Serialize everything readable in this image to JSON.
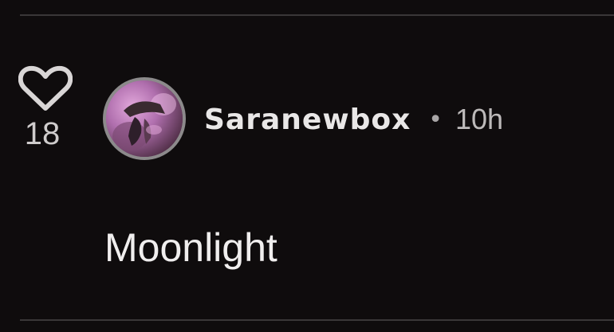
{
  "post": {
    "like_count": "18",
    "username": "Saranewbox",
    "separator": "•",
    "timestamp": "10h",
    "text": "Moonlight"
  },
  "icons": {
    "like": "heart-icon",
    "avatar": "user-avatar"
  },
  "colors": {
    "background": "#0f0c0d",
    "divider": "#3a3738",
    "text_primary": "#e9e7e7",
    "text_secondary": "#bdbaba"
  }
}
